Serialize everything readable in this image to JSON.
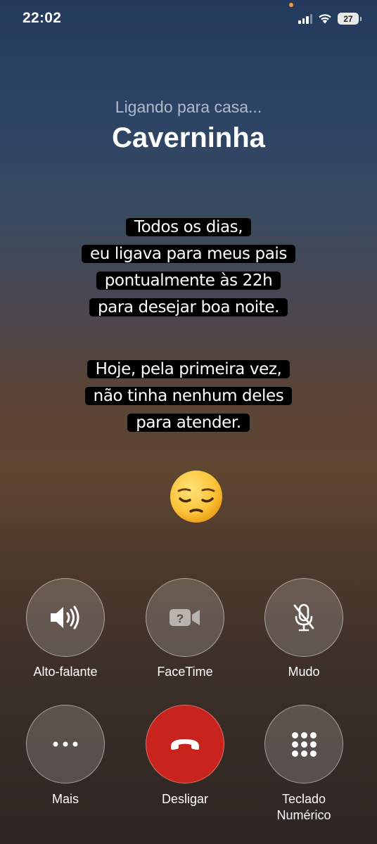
{
  "status_bar": {
    "time": "22:02",
    "battery": "27"
  },
  "call": {
    "status": "Ligando para casa...",
    "contact": "Caverninha"
  },
  "caption_1": {
    "lines": [
      "Todos os dias,",
      "eu ligava para meus pais",
      "pontualmente às 22h",
      "para desejar boa noite."
    ]
  },
  "caption_2": {
    "lines": [
      "Hoje, pela primeira vez,",
      "não tinha nenhum deles",
      "para atender."
    ]
  },
  "emoji": "pensive-face",
  "controls": {
    "speaker": "Alto-falante",
    "facetime": "FaceTime",
    "mute": "Mudo",
    "more": "Mais",
    "end": "Desligar",
    "keypad_line1": "Teclado",
    "keypad_line2": "Numérico"
  },
  "colors": {
    "end_call": "#c8241d",
    "caption_bg": "#000000"
  }
}
